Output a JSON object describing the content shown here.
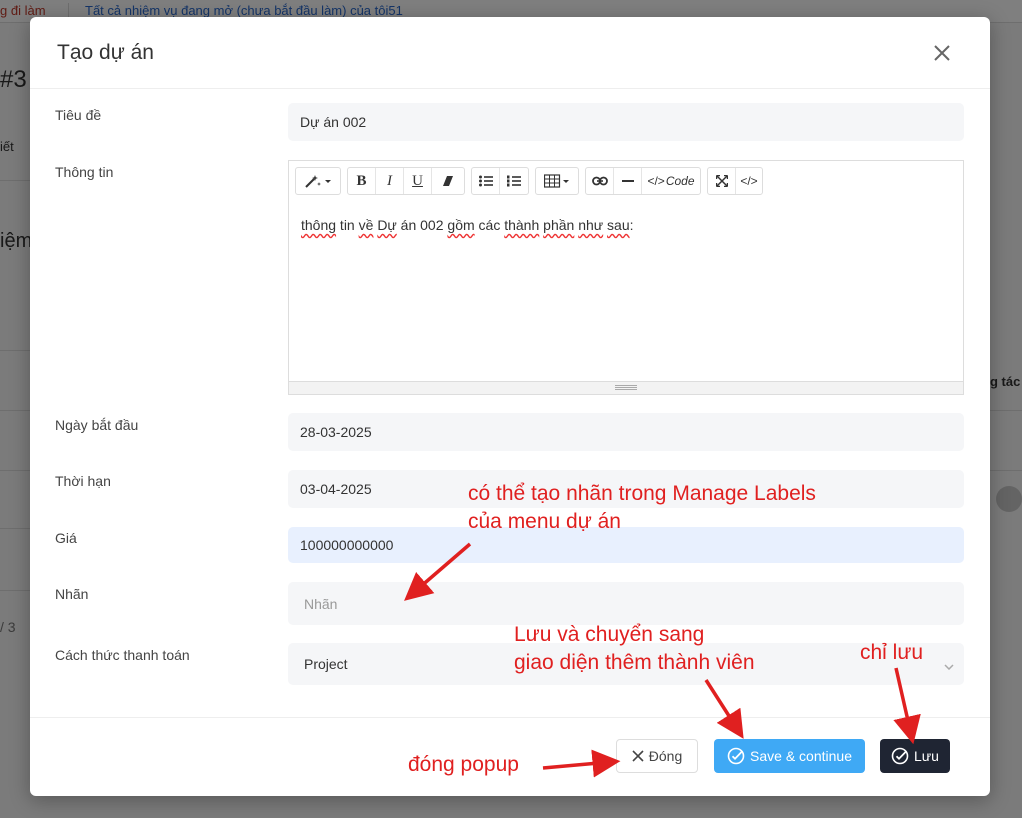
{
  "background": {
    "tab_left": "g đi làm",
    "tab_right": "Tất cả nhiệm vụ đang mở (chưa bắt đầu làm) của tôi51",
    "frag_hash": "#3",
    "frag_tiet": "iết",
    "frag_iem": "iệm",
    "frag_gtac": "g tác",
    "frag_page": "/ 3"
  },
  "modal": {
    "title": "Tạo dự án",
    "fields": {
      "title_label": "Tiêu đề",
      "title_value": "Dự án 002",
      "info_label": "Thông tin",
      "start_label": "Ngày bắt đầu",
      "start_value": "28-03-2025",
      "deadline_label": "Thời hạn",
      "deadline_value": "03-04-2025",
      "price_label": "Giá",
      "price_value": "100000000000",
      "labels_label": "Nhãn",
      "labels_placeholder": "Nhãn",
      "payment_label": "Cách thức thanh toán",
      "payment_value": "Project"
    },
    "editor": {
      "content_parts": [
        "thông",
        " tin ",
        "về",
        " ",
        "Dự",
        " án 002 ",
        "gồm",
        " các ",
        "thành",
        " ",
        "phần",
        " ",
        "như",
        " ",
        "sau",
        ":"
      ],
      "code_label": "Code"
    },
    "footer": {
      "close_label": "Đóng",
      "save_continue_label": "Save & continue",
      "save_label": "Lưu"
    }
  },
  "annotations": {
    "labels_note_line1": "có thể tạo nhãn trong Manage Labels",
    "labels_note_line2": "của menu dự án",
    "save_continue_note_line1": "Lưu và chuyển sang",
    "save_continue_note_line2": "giao diện thêm thành viên",
    "save_note": "chỉ lưu",
    "close_note": "đóng popup"
  },
  "colors": {
    "annotation": "#e02020",
    "save_continue_bg": "#3fa9f5",
    "save_bg": "#1f2533",
    "price_field_bg": "#e8f0fe"
  }
}
